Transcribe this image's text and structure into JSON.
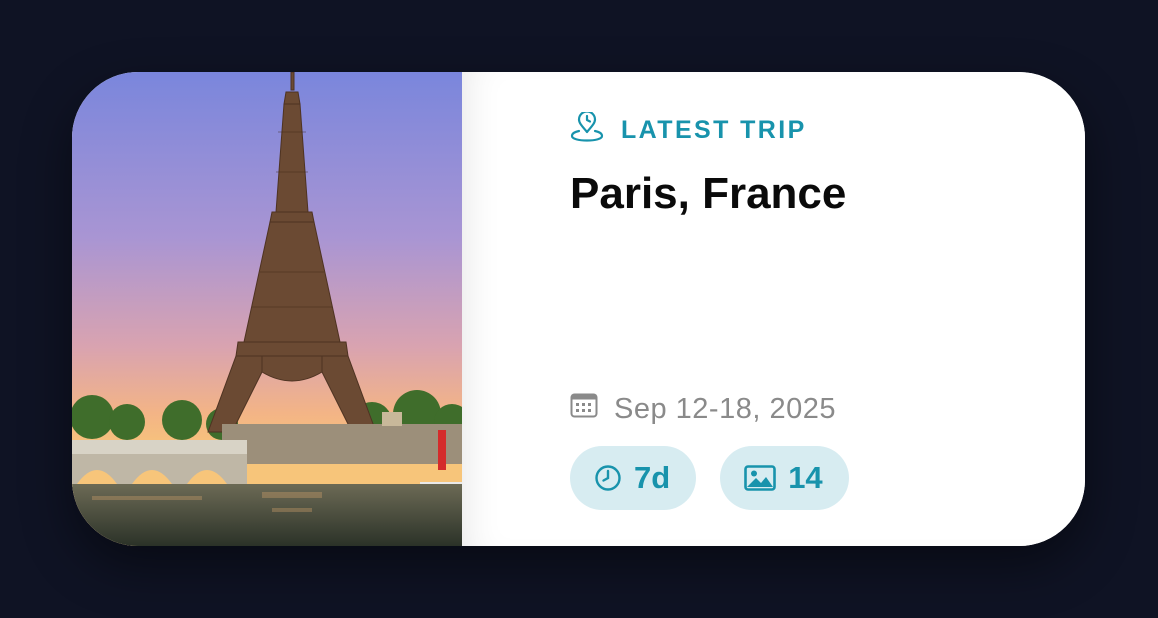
{
  "trip_card": {
    "eyebrow_icon": "location-pin-icon",
    "eyebrow_label": "LATEST TRIP",
    "destination": "Paris, France",
    "date_icon": "calendar-icon",
    "date_range": "Sep 12-18, 2025",
    "photo_subject": "Eiffel Tower at sunset",
    "chips": [
      {
        "icon": "clock-icon",
        "label": "7d"
      },
      {
        "icon": "image-icon",
        "label": "14"
      }
    ],
    "colors": {
      "accent": "#1893ac",
      "chip_bg": "#d7ecf1",
      "page_bg": "#0f1324",
      "title": "#0a0a0a",
      "muted": "#8a8a8a"
    }
  }
}
